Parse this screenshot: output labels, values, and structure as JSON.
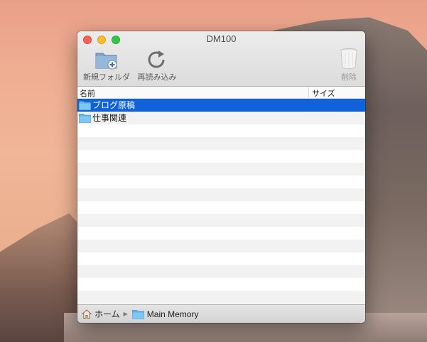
{
  "window": {
    "title": "DM100"
  },
  "toolbar": {
    "new_folder_label": "新規フォルダ",
    "reload_label": "再読み込み",
    "delete_label": "削除"
  },
  "columns": {
    "name": "名前",
    "size": "サイズ"
  },
  "items": [
    {
      "name": "ブログ原稿",
      "icon": "folder-icon",
      "selected": true
    },
    {
      "name": "仕事関連",
      "icon": "folder-icon",
      "selected": false
    }
  ],
  "breadcrumb": {
    "home": "ホーム",
    "current": "Main Memory"
  },
  "colors": {
    "selection": "#1162d9",
    "folder": "#5fb4ec"
  }
}
